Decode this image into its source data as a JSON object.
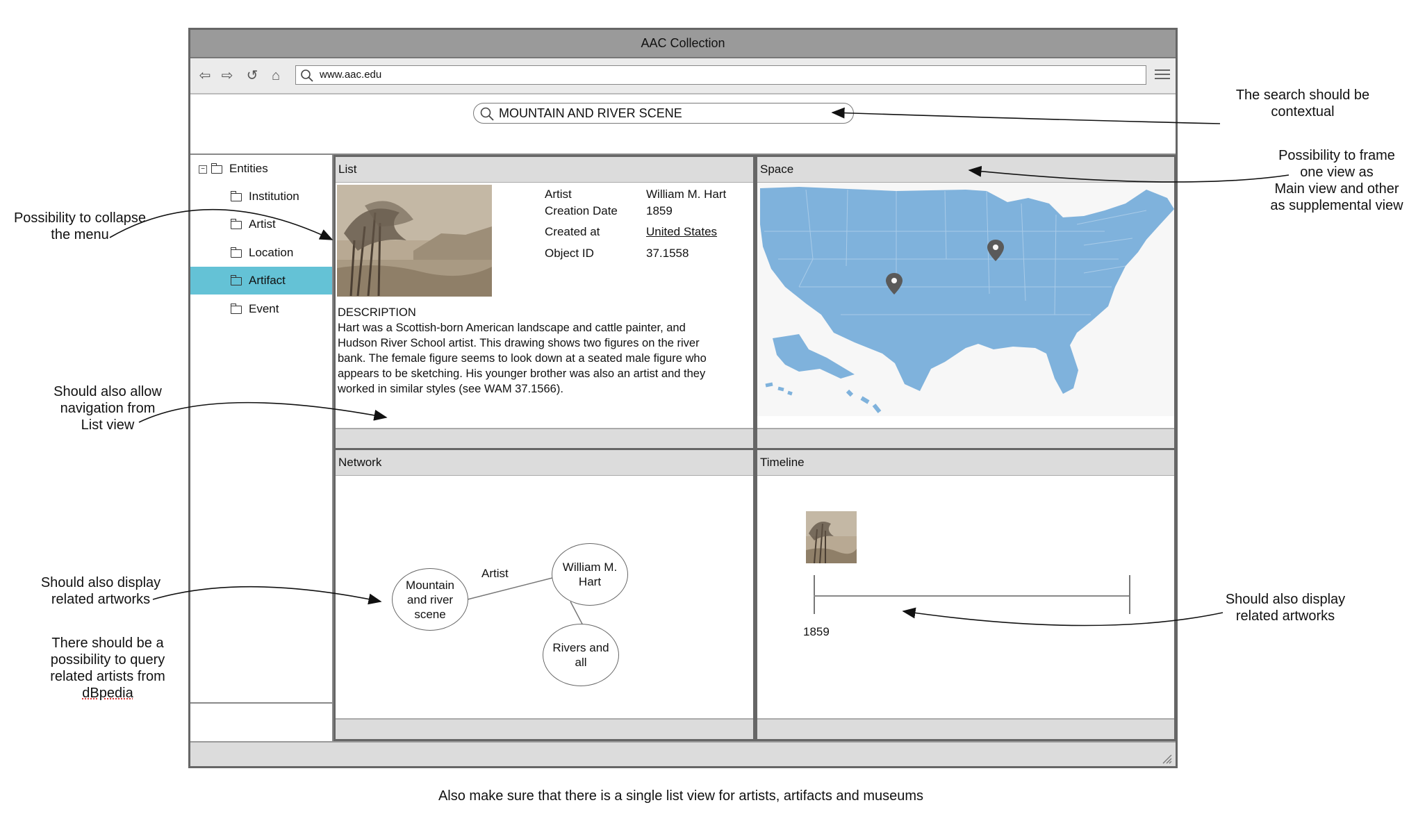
{
  "window": {
    "title": "AAC Collection",
    "url": "www.aac.edu"
  },
  "search": {
    "value": "MOUNTAIN AND RIVER SCENE"
  },
  "sidebar": {
    "root": "Entities",
    "items": [
      {
        "label": "Institution"
      },
      {
        "label": "Artist"
      },
      {
        "label": "Location"
      },
      {
        "label": "Artifact",
        "active": true
      },
      {
        "label": "Event"
      }
    ]
  },
  "list_panel": {
    "title": "List",
    "fields": [
      {
        "label": "Artist",
        "value": "William M. Hart"
      },
      {
        "label": "Creation Date",
        "value": "1859"
      },
      {
        "label": "Created at",
        "value": "United States"
      },
      {
        "label": "Object ID",
        "value": "37.1558"
      }
    ],
    "description_heading": "DESCRIPTION",
    "description_lines": [
      "Hart was a Scottish-born American landscape and cattle painter, and",
      "Hudson River School artist. This drawing shows two figures on the river",
      "bank. The female figure seems to look down at a seated male figure who",
      "appears to be sketching. His younger brother was also an artist and they",
      "worked in similar styles (see WAM 37.1566)."
    ]
  },
  "space_panel": {
    "title": "Space"
  },
  "network_panel": {
    "title": "Network",
    "edge_label": "Artist",
    "nodes": [
      {
        "lines": [
          "Mountain",
          "and river",
          "scene"
        ]
      },
      {
        "lines": [
          "William M.",
          "Hart"
        ]
      },
      {
        "lines": [
          "Rivers and",
          "all"
        ]
      }
    ]
  },
  "timeline_panel": {
    "title": "Timeline",
    "year": "1859"
  },
  "annotations": {
    "search": [
      "The search should be",
      "contextual"
    ],
    "frame": [
      "Possibility to frame",
      "one view as",
      "Main view and other",
      "as supplemental view"
    ],
    "collapse": [
      "Possibility to collapse",
      "the menu"
    ],
    "navigation": [
      "Should also allow",
      "navigation from",
      "List view"
    ],
    "network_related": [
      "Should also display",
      "related artworks"
    ],
    "dbpedia": [
      "There should be a",
      "possibility to query",
      "related artists from",
      "dBpedia"
    ],
    "timeline_related": [
      "Should also display",
      "related artworks"
    ],
    "footer": "Also make sure that there is a single list view for artists, artifacts and museums"
  },
  "colors": {
    "active_item": "#64c2d6",
    "map": "#7fb2dc",
    "pin": "#5a5a5a"
  }
}
